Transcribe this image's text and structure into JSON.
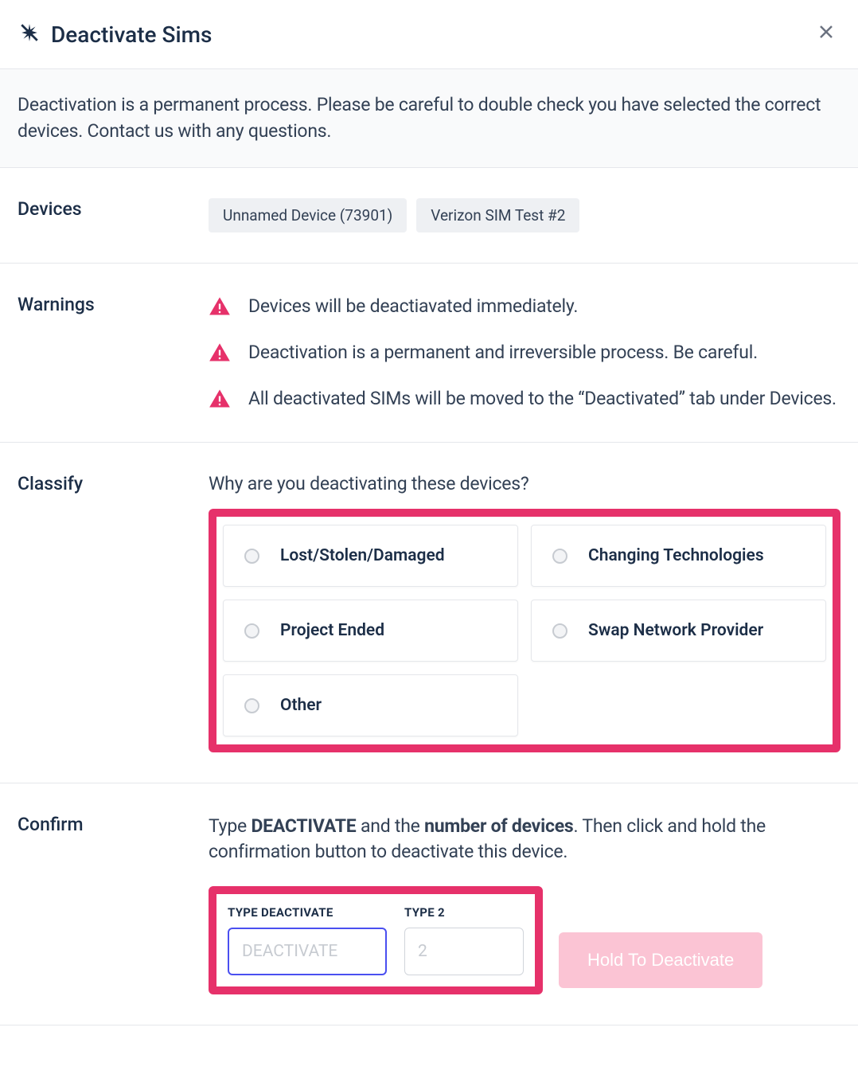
{
  "header": {
    "title": "Deactivate Sims"
  },
  "banner": "Deactivation is a permanent process. Please be careful to double check you have selected the correct devices. Contact us with any questions.",
  "devices": {
    "label": "Devices",
    "items": [
      "Unnamed Device (73901)",
      "Verizon SIM Test #2"
    ]
  },
  "warnings": {
    "label": "Warnings",
    "items": [
      "Devices will be deactiavated immediately.",
      "Deactivation is a permanent and irreversible process. Be careful.",
      "All deactivated SIMs will be moved to the “Deactivated” tab under Devices."
    ]
  },
  "classify": {
    "label": "Classify",
    "question": "Why are you deactivating these devices?",
    "options": [
      "Lost/Stolen/Damaged",
      "Changing Technologies",
      "Project Ended",
      "Swap Network Provider",
      "Other"
    ]
  },
  "confirm": {
    "label": "Confirm",
    "text_prefix": "Type ",
    "text_word": "DEACTIVATE",
    "text_mid": " and the ",
    "text_count": "number of devices",
    "text_suffix": ". Then click and hold the confirmation button to deactivate this device.",
    "input1_label": "TYPE DEACTIVATE",
    "input1_placeholder": "DEACTIVATE",
    "input2_label": "TYPE 2",
    "input2_placeholder": "2",
    "button": "Hold To Deactivate"
  }
}
